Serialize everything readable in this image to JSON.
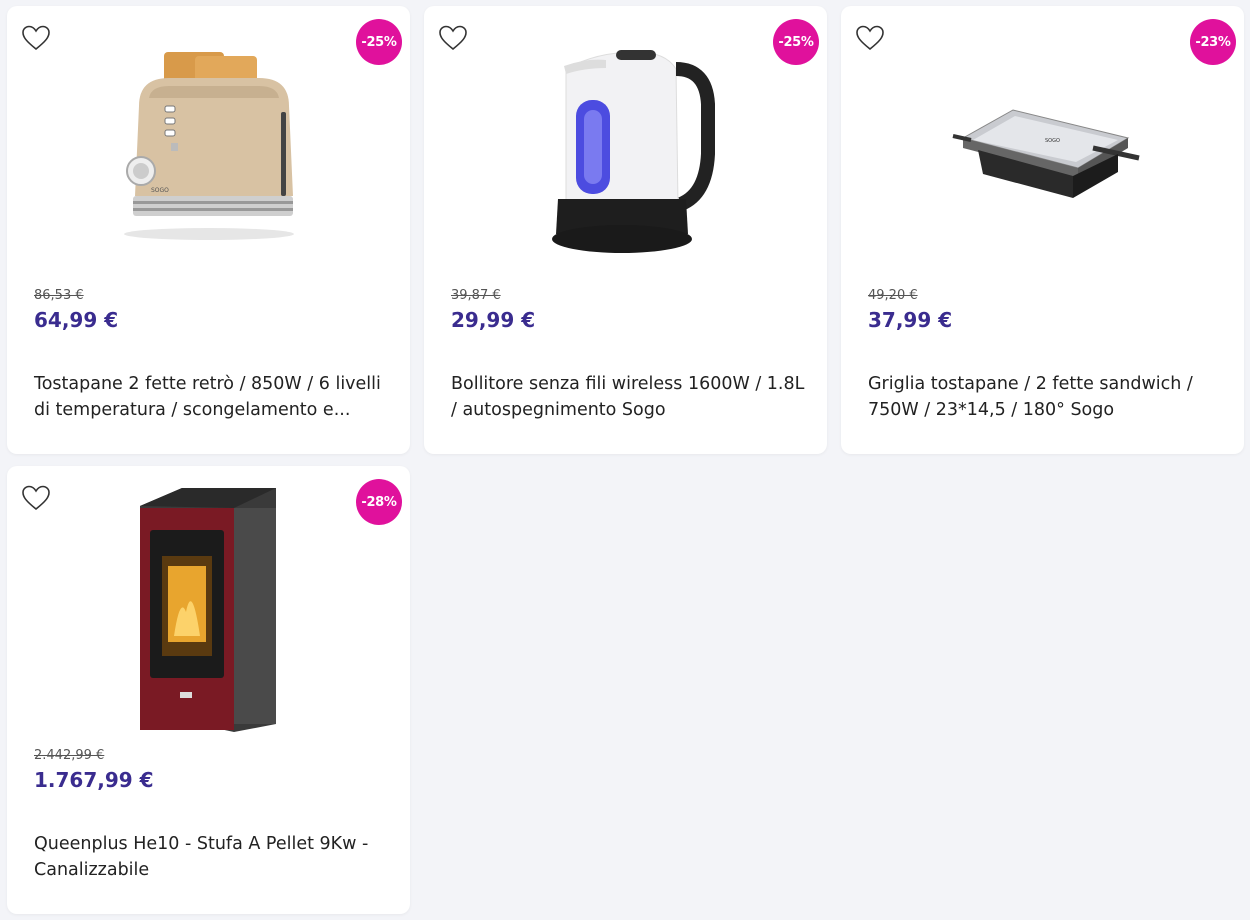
{
  "products": [
    {
      "discount": "-25%",
      "old_price": "86,53 €",
      "price": "64,99 €",
      "title": "Tostapane 2 fette retrò / 850W / 6 livelli di temperatura / scongelamento e...",
      "image": "toaster"
    },
    {
      "discount": "-25%",
      "old_price": "39,87 €",
      "price": "29,99 €",
      "title": "Bollitore senza fili wireless 1600W / 1.8L / autospegnimento Sogo",
      "image": "kettle"
    },
    {
      "discount": "-23%",
      "old_price": "49,20 €",
      "price": "37,99 €",
      "title": "Griglia tostapane / 2 fette sandwich / 750W / 23*14,5 / 180° Sogo",
      "image": "sandwich-grill"
    },
    {
      "discount": "-28%",
      "old_price": "2.442,99 €",
      "price": "1.767,99 €",
      "title": "Queenplus He10 - Stufa A Pellet 9Kw - Canalizzabile",
      "image": "pellet-stove"
    }
  ],
  "colors": {
    "accent": "#3a2c8f",
    "badge": "#e0119c",
    "background": "#f3f4f8"
  }
}
